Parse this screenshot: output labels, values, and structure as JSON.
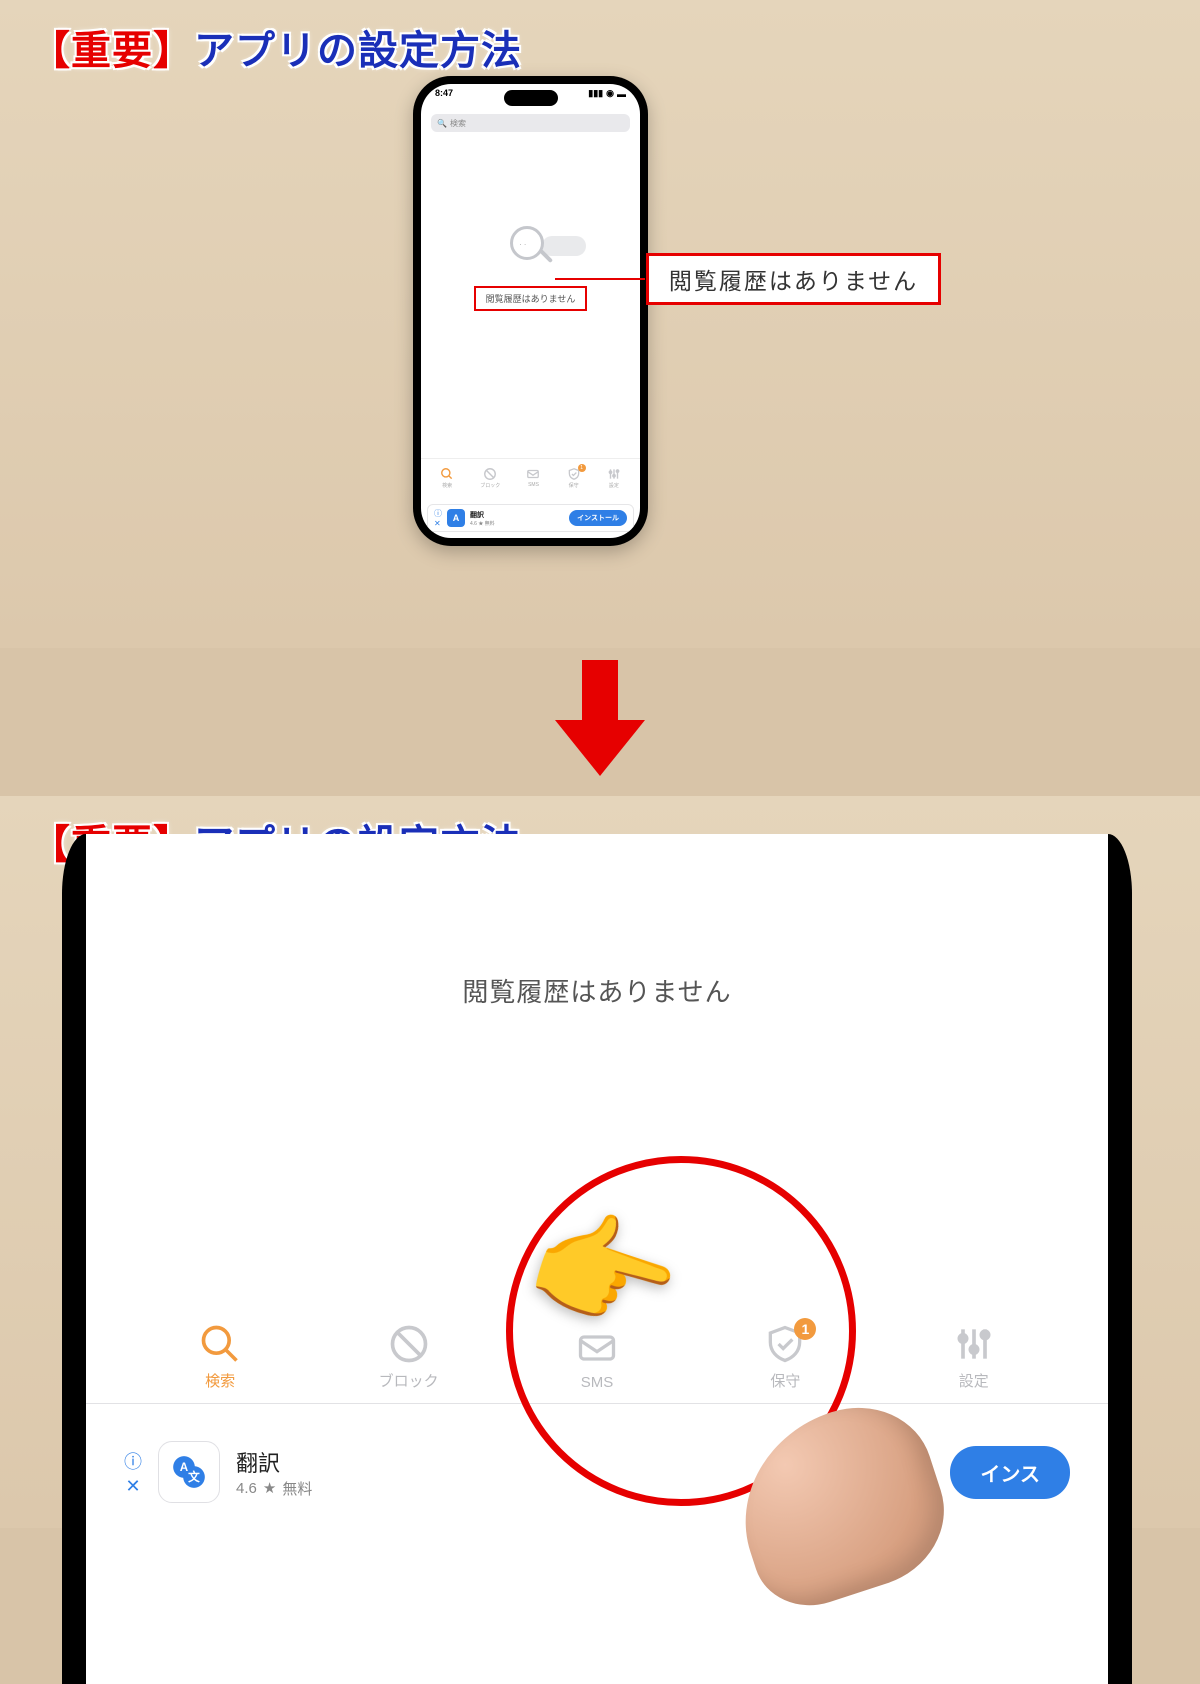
{
  "title": {
    "important": "【重要】",
    "rest": "アプリの設定方法"
  },
  "callout": "閲覧履歴はありません",
  "phone": {
    "status_time": "8:47",
    "search_placeholder": "検索",
    "empty_message": "閲覧履歴はありません",
    "tabs": [
      {
        "id": "search",
        "label": "検索",
        "active": true
      },
      {
        "id": "block",
        "label": "ブロック"
      },
      {
        "id": "sms",
        "label": "SMS"
      },
      {
        "id": "protect",
        "label": "保守",
        "badge": "1"
      },
      {
        "id": "settings",
        "label": "設定"
      }
    ],
    "ad": {
      "name": "翻訳",
      "rating": "4.6",
      "price": "無料",
      "cta": "インストール",
      "cta_partial": "インス"
    }
  }
}
